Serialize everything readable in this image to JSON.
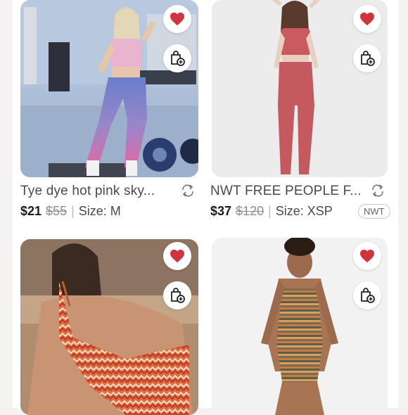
{
  "listings": [
    {
      "title": "Tye dye hot pink sky...",
      "price": "$21",
      "original_price": "$55",
      "size": "Size: M",
      "liked": true,
      "badge": ""
    },
    {
      "title": "NWT FREE PEOPLE F...",
      "price": "$37",
      "original_price": "$120",
      "size": "Size: XSP",
      "liked": true,
      "badge": "NWT"
    },
    {
      "title": "",
      "price": "",
      "original_price": "",
      "size": "",
      "liked": true,
      "badge": ""
    },
    {
      "title": "",
      "price": "",
      "original_price": "",
      "size": "",
      "liked": true,
      "badge": ""
    }
  ],
  "colors": {
    "heart": "#cf3440",
    "text": "#4a4a4a",
    "price": "#1b1b1b",
    "strike": "#8d8d8d"
  },
  "icons": {
    "like": "heart-icon",
    "bag": "add-to-bag-icon",
    "share": "share-icon"
  }
}
